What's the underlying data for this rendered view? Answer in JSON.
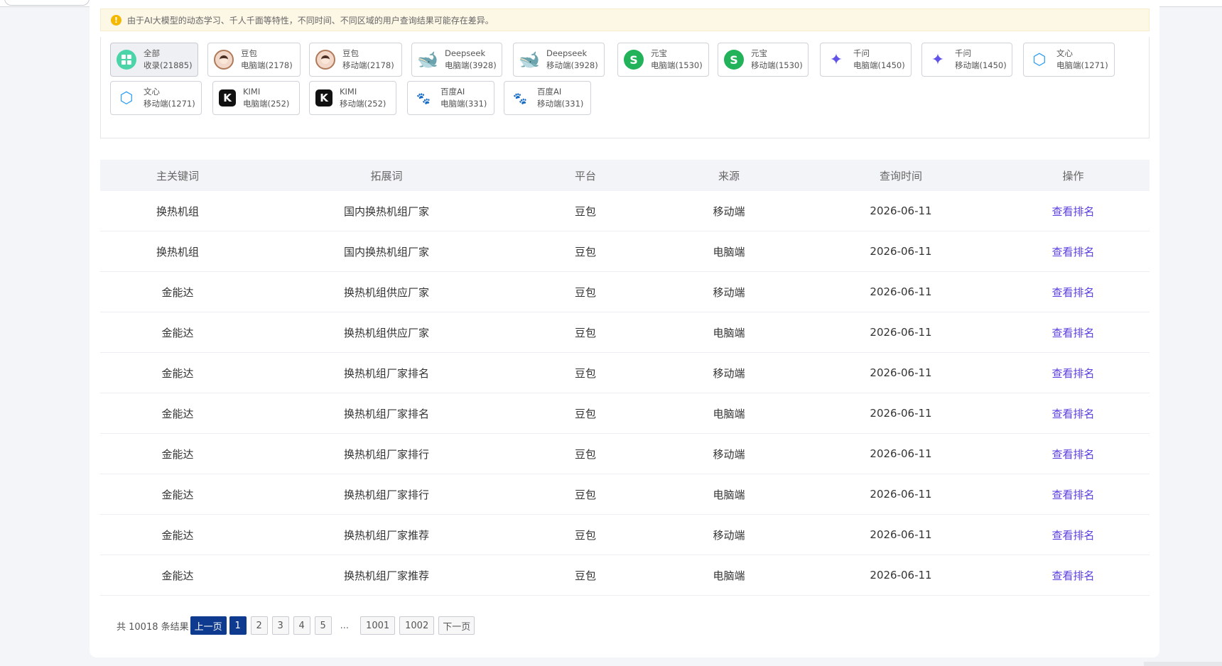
{
  "notice": "由于AI大模型的动态学习、千人千面等特性，不同时间、不同区域的用户查询结果可能存在差异。",
  "filters": [
    {
      "icon": "grid-icon",
      "l1": "全部",
      "l2": "收录(21885)",
      "active": true
    },
    {
      "icon": "doubao-avatar-icon",
      "l1": "豆包",
      "l2": "电脑端(2178)"
    },
    {
      "icon": "doubao-avatar-icon",
      "l1": "豆包",
      "l2": "移动端(2178)"
    },
    {
      "icon": "deepseek-whale-icon",
      "l1": "Deepseek",
      "l2": "电脑端(3928)"
    },
    {
      "icon": "deepseek-whale-icon",
      "l1": "Deepseek",
      "l2": "移动端(3928)"
    },
    {
      "icon": "yuanbao-icon",
      "l1": "元宝",
      "l2": "电脑端(1530)"
    },
    {
      "icon": "yuanbao-icon",
      "l1": "元宝",
      "l2": "移动端(1530)"
    },
    {
      "icon": "qianwen-icon",
      "l1": "千问",
      "l2": "电脑端(1450)"
    },
    {
      "icon": "qianwen-icon",
      "l1": "千问",
      "l2": "移动端(1450)"
    },
    {
      "icon": "wenxin-icon",
      "l1": "文心",
      "l2": "电脑端(1271)"
    },
    {
      "icon": "wenxin-icon",
      "l1": "文心",
      "l2": "移动端(1271)"
    },
    {
      "icon": "kimi-icon",
      "l1": "KIMI",
      "l2": "电脑端(252)"
    },
    {
      "icon": "kimi-icon",
      "l1": "KIMI",
      "l2": "移动端(252)"
    },
    {
      "icon": "baidu-paw-icon",
      "l1": "百度AI",
      "l2": "电脑端(331)"
    },
    {
      "icon": "baidu-paw-icon",
      "l1": "百度AI",
      "l2": "移动端(331)"
    }
  ],
  "table": {
    "headers": [
      "主关键词",
      "拓展词",
      "平台",
      "来源",
      "查询时间",
      "操作"
    ],
    "rows": [
      [
        "换热机组",
        "国内换热机组厂家",
        "豆包",
        "移动端",
        "2026-06-11",
        "查看排名"
      ],
      [
        "换热机组",
        "国内换热机组厂家",
        "豆包",
        "电脑端",
        "2026-06-11",
        "查看排名"
      ],
      [
        "金能达",
        "换热机组供应厂家",
        "豆包",
        "移动端",
        "2026-06-11",
        "查看排名"
      ],
      [
        "金能达",
        "换热机组供应厂家",
        "豆包",
        "电脑端",
        "2026-06-11",
        "查看排名"
      ],
      [
        "金能达",
        "换热机组厂家排名",
        "豆包",
        "移动端",
        "2026-06-11",
        "查看排名"
      ],
      [
        "金能达",
        "换热机组厂家排名",
        "豆包",
        "电脑端",
        "2026-06-11",
        "查看排名"
      ],
      [
        "金能达",
        "换热机组厂家排行",
        "豆包",
        "移动端",
        "2026-06-11",
        "查看排名"
      ],
      [
        "金能达",
        "换热机组厂家排行",
        "豆包",
        "电脑端",
        "2026-06-11",
        "查看排名"
      ],
      [
        "金能达",
        "换热机组厂家推荐",
        "豆包",
        "移动端",
        "2026-06-11",
        "查看排名"
      ],
      [
        "金能达",
        "换热机组厂家推荐",
        "豆包",
        "电脑端",
        "2026-06-11",
        "查看排名"
      ]
    ]
  },
  "pagination": {
    "total_text": "共 10018 条结果",
    "prev": "上一页",
    "pages": [
      "1",
      "2",
      "3",
      "4",
      "5"
    ],
    "current": "1",
    "ellipsis": "...",
    "tail_pages": [
      "1001",
      "1002"
    ],
    "next": "下一页"
  },
  "colors": {
    "link": "#5a3de0",
    "primary": "#0e3b8f",
    "notice_bg": "#fdf7e6",
    "warning_icon": "#f5b800"
  }
}
